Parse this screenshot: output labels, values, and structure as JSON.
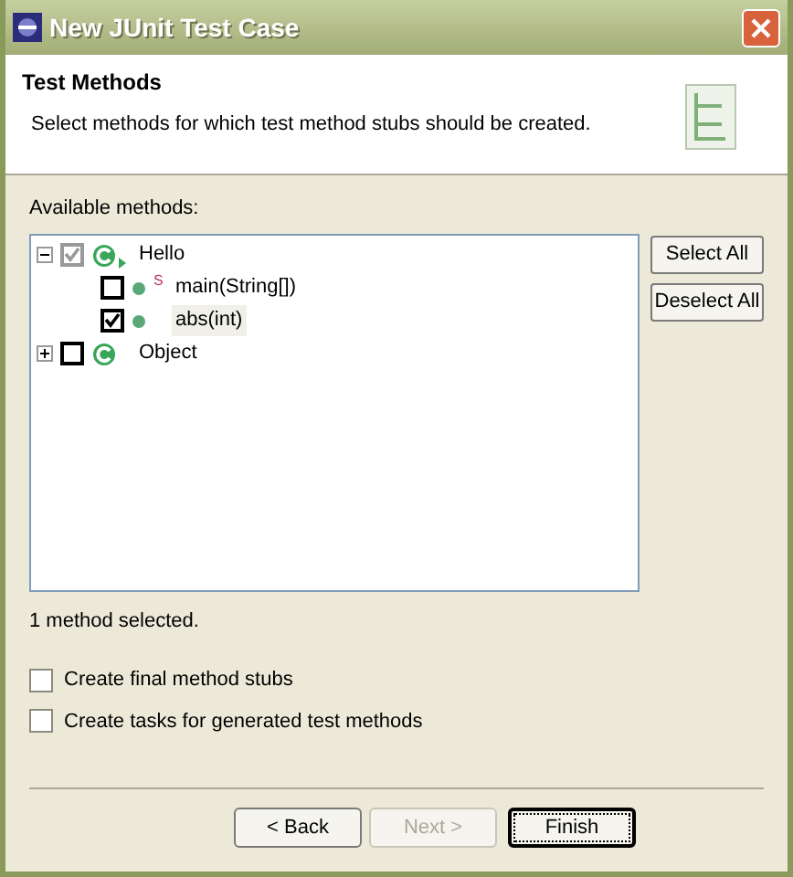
{
  "window": {
    "title": "New JUnit Test Case"
  },
  "header": {
    "title": "Test Methods",
    "description": "Select methods for which test method stubs should be created."
  },
  "tree_label": "Available methods:",
  "tree": [
    {
      "label": "Hello",
      "kind": "class",
      "expanded": true,
      "checked": true,
      "grayed": true,
      "selected": false,
      "children": [
        {
          "label": "main(String[])",
          "kind": "method",
          "modifier": "S",
          "checked": false,
          "grayed": false,
          "selected": false
        },
        {
          "label": "abs(int)",
          "kind": "method",
          "checked": true,
          "grayed": false,
          "selected": true
        }
      ]
    },
    {
      "label": "Object",
      "kind": "class",
      "expanded": false,
      "checked": false,
      "grayed": false,
      "selected": false
    }
  ],
  "side_buttons": [
    "Select All",
    "Deselect All"
  ],
  "status": "1 method selected.",
  "options": [
    {
      "label": "Create final method stubs",
      "checked": false
    },
    {
      "label": "Create tasks for generated test methods",
      "checked": false
    }
  ],
  "footer_buttons": [
    {
      "label": "< Back",
      "disabled": false,
      "focused": false
    },
    {
      "label": "Next >",
      "disabled": true,
      "focused": false
    },
    {
      "label": "Finish",
      "disabled": false,
      "focused": true
    }
  ]
}
